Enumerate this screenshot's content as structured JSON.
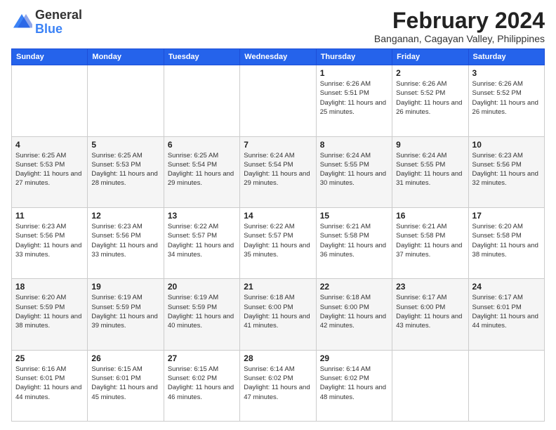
{
  "header": {
    "logo": {
      "line1": "General",
      "line2": "Blue"
    },
    "title": "February 2024",
    "subtitle": "Banganan, Cagayan Valley, Philippines"
  },
  "days_of_week": [
    "Sunday",
    "Monday",
    "Tuesday",
    "Wednesday",
    "Thursday",
    "Friday",
    "Saturday"
  ],
  "weeks": [
    [
      {
        "day": "",
        "sunrise": "",
        "sunset": "",
        "daylight": ""
      },
      {
        "day": "",
        "sunrise": "",
        "sunset": "",
        "daylight": ""
      },
      {
        "day": "",
        "sunrise": "",
        "sunset": "",
        "daylight": ""
      },
      {
        "day": "",
        "sunrise": "",
        "sunset": "",
        "daylight": ""
      },
      {
        "day": "1",
        "sunrise": "6:26 AM",
        "sunset": "5:51 PM",
        "daylight": "11 hours and 25 minutes."
      },
      {
        "day": "2",
        "sunrise": "6:26 AM",
        "sunset": "5:52 PM",
        "daylight": "11 hours and 26 minutes."
      },
      {
        "day": "3",
        "sunrise": "6:26 AM",
        "sunset": "5:52 PM",
        "daylight": "11 hours and 26 minutes."
      }
    ],
    [
      {
        "day": "4",
        "sunrise": "6:25 AM",
        "sunset": "5:53 PM",
        "daylight": "11 hours and 27 minutes."
      },
      {
        "day": "5",
        "sunrise": "6:25 AM",
        "sunset": "5:53 PM",
        "daylight": "11 hours and 28 minutes."
      },
      {
        "day": "6",
        "sunrise": "6:25 AM",
        "sunset": "5:54 PM",
        "daylight": "11 hours and 29 minutes."
      },
      {
        "day": "7",
        "sunrise": "6:24 AM",
        "sunset": "5:54 PM",
        "daylight": "11 hours and 29 minutes."
      },
      {
        "day": "8",
        "sunrise": "6:24 AM",
        "sunset": "5:55 PM",
        "daylight": "11 hours and 30 minutes."
      },
      {
        "day": "9",
        "sunrise": "6:24 AM",
        "sunset": "5:55 PM",
        "daylight": "11 hours and 31 minutes."
      },
      {
        "day": "10",
        "sunrise": "6:23 AM",
        "sunset": "5:56 PM",
        "daylight": "11 hours and 32 minutes."
      }
    ],
    [
      {
        "day": "11",
        "sunrise": "6:23 AM",
        "sunset": "5:56 PM",
        "daylight": "11 hours and 33 minutes."
      },
      {
        "day": "12",
        "sunrise": "6:23 AM",
        "sunset": "5:56 PM",
        "daylight": "11 hours and 33 minutes."
      },
      {
        "day": "13",
        "sunrise": "6:22 AM",
        "sunset": "5:57 PM",
        "daylight": "11 hours and 34 minutes."
      },
      {
        "day": "14",
        "sunrise": "6:22 AM",
        "sunset": "5:57 PM",
        "daylight": "11 hours and 35 minutes."
      },
      {
        "day": "15",
        "sunrise": "6:21 AM",
        "sunset": "5:58 PM",
        "daylight": "11 hours and 36 minutes."
      },
      {
        "day": "16",
        "sunrise": "6:21 AM",
        "sunset": "5:58 PM",
        "daylight": "11 hours and 37 minutes."
      },
      {
        "day": "17",
        "sunrise": "6:20 AM",
        "sunset": "5:58 PM",
        "daylight": "11 hours and 38 minutes."
      }
    ],
    [
      {
        "day": "18",
        "sunrise": "6:20 AM",
        "sunset": "5:59 PM",
        "daylight": "11 hours and 38 minutes."
      },
      {
        "day": "19",
        "sunrise": "6:19 AM",
        "sunset": "5:59 PM",
        "daylight": "11 hours and 39 minutes."
      },
      {
        "day": "20",
        "sunrise": "6:19 AM",
        "sunset": "5:59 PM",
        "daylight": "11 hours and 40 minutes."
      },
      {
        "day": "21",
        "sunrise": "6:18 AM",
        "sunset": "6:00 PM",
        "daylight": "11 hours and 41 minutes."
      },
      {
        "day": "22",
        "sunrise": "6:18 AM",
        "sunset": "6:00 PM",
        "daylight": "11 hours and 42 minutes."
      },
      {
        "day": "23",
        "sunrise": "6:17 AM",
        "sunset": "6:00 PM",
        "daylight": "11 hours and 43 minutes."
      },
      {
        "day": "24",
        "sunrise": "6:17 AM",
        "sunset": "6:01 PM",
        "daylight": "11 hours and 44 minutes."
      }
    ],
    [
      {
        "day": "25",
        "sunrise": "6:16 AM",
        "sunset": "6:01 PM",
        "daylight": "11 hours and 44 minutes."
      },
      {
        "day": "26",
        "sunrise": "6:15 AM",
        "sunset": "6:01 PM",
        "daylight": "11 hours and 45 minutes."
      },
      {
        "day": "27",
        "sunrise": "6:15 AM",
        "sunset": "6:02 PM",
        "daylight": "11 hours and 46 minutes."
      },
      {
        "day": "28",
        "sunrise": "6:14 AM",
        "sunset": "6:02 PM",
        "daylight": "11 hours and 47 minutes."
      },
      {
        "day": "29",
        "sunrise": "6:14 AM",
        "sunset": "6:02 PM",
        "daylight": "11 hours and 48 minutes."
      },
      {
        "day": "",
        "sunrise": "",
        "sunset": "",
        "daylight": ""
      },
      {
        "day": "",
        "sunrise": "",
        "sunset": "",
        "daylight": ""
      }
    ]
  ]
}
